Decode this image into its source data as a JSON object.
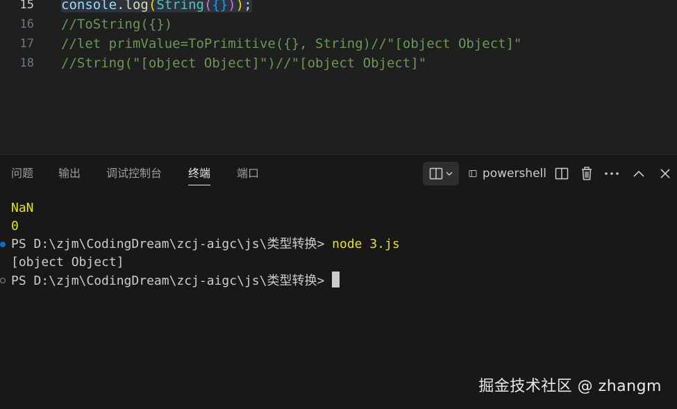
{
  "editor": {
    "lines": [
      {
        "number": "15",
        "active": true
      },
      {
        "number": "16",
        "text": "//ToString({})"
      },
      {
        "number": "17",
        "text": "//let primValue=ToPrimitive({}, String)//\"[object Object]\""
      },
      {
        "number": "18",
        "text": "//String(\"[object Object]\")//\"[object Object]\""
      }
    ],
    "line15_tokens": {
      "obj": "console",
      "dot": ".",
      "fn": "log",
      "p1": "(",
      "cls": "String",
      "p2": "(",
      "brace": "{}",
      "p3": ")",
      "p4": ")",
      "semi": ";"
    }
  },
  "panel": {
    "tabs": [
      {
        "label": "问题",
        "active": false
      },
      {
        "label": "输出",
        "active": false
      },
      {
        "label": "调试控制台",
        "active": false
      },
      {
        "label": "终端",
        "active": true
      },
      {
        "label": "端口",
        "active": false
      }
    ],
    "terminal_name": "powershell",
    "icons": {
      "layout": "split-layout-icon",
      "dropdown": "chevron-down-icon",
      "terminal": "terminal-icon",
      "split": "split-terminal-icon",
      "trash": "trash-icon",
      "more": "more-icon",
      "maximize": "chevron-up-icon",
      "close": "close-icon"
    }
  },
  "terminal": {
    "lines": [
      {
        "text": "NaN"
      },
      {
        "text": "0"
      },
      {
        "prompt": "PS D:\\zjm\\CodingDream\\zcj-aigc\\js\\类型转换> ",
        "command": "node 3.js"
      },
      {
        "text": "[object Object]"
      },
      {
        "prompt": "PS D:\\zjm\\CodingDream\\zcj-aigc\\js\\类型转换> "
      }
    ]
  },
  "watermark": "掘金技术社区 @ zhangm"
}
